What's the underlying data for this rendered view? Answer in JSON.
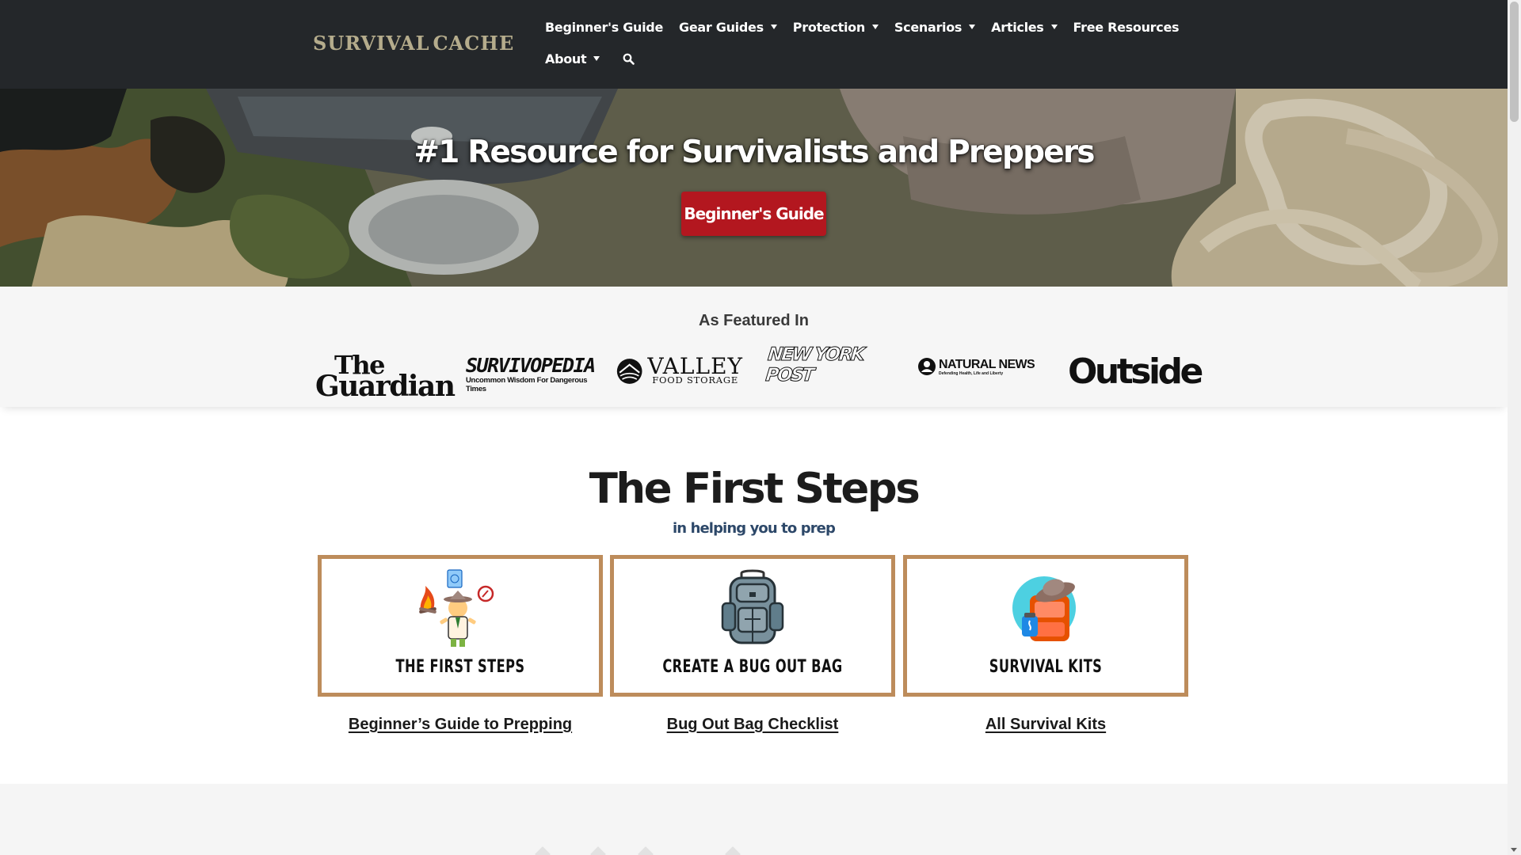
{
  "header": {
    "logo": {
      "text_left": "SURVIVAL",
      "text_right": "CACHE"
    },
    "nav": {
      "row1": [
        {
          "label": "Beginner's Guide",
          "dropdown": false
        },
        {
          "label": "Gear Guides",
          "dropdown": true
        },
        {
          "label": "Protection",
          "dropdown": true
        },
        {
          "label": "Scenarios",
          "dropdown": true
        },
        {
          "label": "Articles",
          "dropdown": true
        },
        {
          "label": "Free Resources",
          "dropdown": false
        }
      ],
      "row2": [
        {
          "label": "About",
          "dropdown": true
        }
      ],
      "search_icon": "search-icon"
    }
  },
  "hero": {
    "title": "#1 Resource for Survivalists and Preppers",
    "button_label": "Beginner's Guide"
  },
  "featured": {
    "title": "As Featured In",
    "logos": {
      "guardian": {
        "line1": "The",
        "line2": "Guardian"
      },
      "survivopedia": {
        "line1": "SURVIVOPEDIA",
        "line2": "Uncommon Wisdom For Dangerous Times"
      },
      "valley": {
        "line1": "VALLEY",
        "line2": "FOOD STORAGE"
      },
      "nypost": "NEW YORK POST",
      "naturalnews": {
        "line1": "NATURAL NEWS",
        "line2": "Defending Health, Life and Liberty"
      },
      "outside": "Outside"
    }
  },
  "first_steps": {
    "title": "The First Steps",
    "subtitle": "in helping you to prep",
    "cards": [
      {
        "label": "THE FIRST STEPS",
        "link": "Beginner’s Guide to Prepping"
      },
      {
        "label": "CREATE A BUG OUT BAG",
        "link": "Bug Out Bag Checklist"
      },
      {
        "label": "SURVIVAL KITS",
        "link": "All Survival Kits"
      }
    ]
  },
  "colors": {
    "header_bg": "#24272a",
    "hero_button": "#b3171f",
    "card_border": "#bd8c5b",
    "subtitle": "#2d4869"
  }
}
